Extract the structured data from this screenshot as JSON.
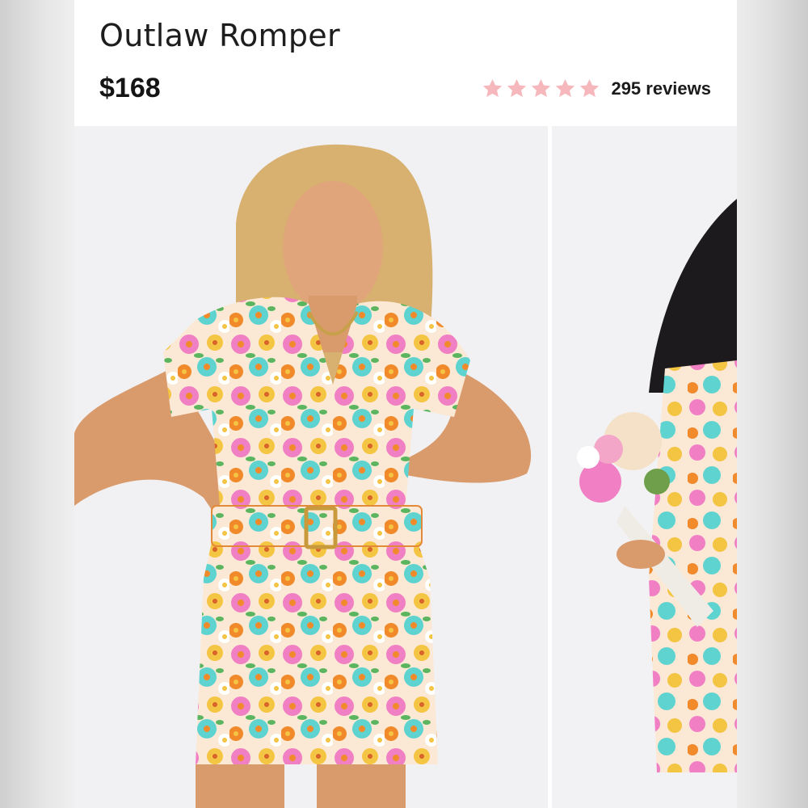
{
  "product": {
    "title": "Outlaw Romper",
    "price": "$168",
    "rating": 5,
    "rating_max": 5,
    "reviews_label": "295 reviews"
  },
  "colors": {
    "star": "#f6b8bc",
    "text": "#1d1d1d",
    "print_pink": "#f07fc4",
    "print_orange": "#f08a2a",
    "print_teal": "#5ed3cf",
    "print_yellow": "#f4c542"
  },
  "icons": {
    "rating_star": "star-icon"
  }
}
